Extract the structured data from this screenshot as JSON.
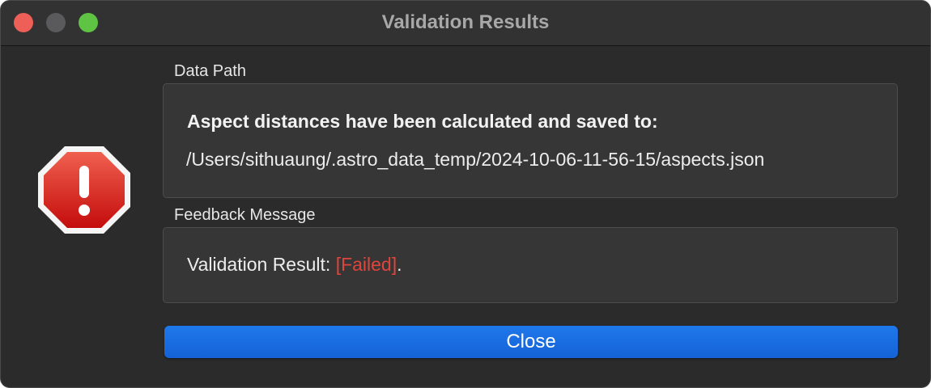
{
  "window": {
    "title": "Validation Results"
  },
  "icons": {
    "alert": "stop-alert-icon",
    "traffic_close": "window-close-icon",
    "traffic_minimize": "window-minimize-icon",
    "traffic_maximize": "window-zoom-icon"
  },
  "data_path": {
    "label": "Data Path",
    "heading": "Aspect distances have been calculated and saved to:",
    "path": "/Users/sithuaung/.astro_data_temp/2024-10-06-11-56-15/aspects.json"
  },
  "feedback": {
    "label": "Feedback Message",
    "prefix": "Validation Result: ",
    "status": "[Failed]",
    "suffix": "."
  },
  "buttons": {
    "close": "Close"
  },
  "colors": {
    "window_bg": "#2b2b2b",
    "status_failed": "#e0443b",
    "accent_button": "#1a6ee0",
    "alert_red": "#d42121"
  }
}
